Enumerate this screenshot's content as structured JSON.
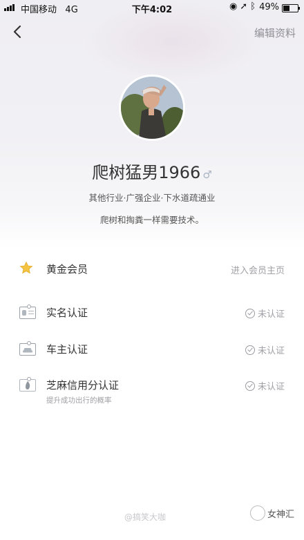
{
  "status_bar": {
    "carrier": "中国移动",
    "network": "4G",
    "time": "下午4:02",
    "battery_percent": "49%",
    "battery_level": 0.49,
    "icons": [
      "orientation-lock-icon",
      "location-icon",
      "bluetooth-icon"
    ]
  },
  "header": {
    "back_icon": "chevron-left-icon",
    "edit_label": "编辑资料"
  },
  "profile": {
    "nickname": "爬树猛男1966",
    "gender_symbol": "♂",
    "industry": "其他行业·广强企业·下水道疏通业",
    "bio": "爬树和掏粪一样需要技术。"
  },
  "menu": {
    "gold_member": {
      "label": "黄金会员",
      "action": "进入会员主页",
      "icon": "star-icon",
      "icon_color": "#f5c342"
    },
    "real_name": {
      "label": "实名认证",
      "status": "未认证",
      "icon": "id-card-icon"
    },
    "car_owner": {
      "label": "车主认证",
      "status": "未认证",
      "icon": "car-card-icon"
    },
    "sesame": {
      "label": "芝麻信用分认证",
      "status": "未认证",
      "hint": "提升成功出行的概率",
      "icon": "sesame-credit-icon"
    }
  },
  "watermark": {
    "weibo": "@搞笑大咖",
    "account": "女神汇"
  },
  "colors": {
    "accent_gray": "#8f8f95",
    "status_gray": "#a0a0a6",
    "star_yellow": "#f5c342"
  }
}
